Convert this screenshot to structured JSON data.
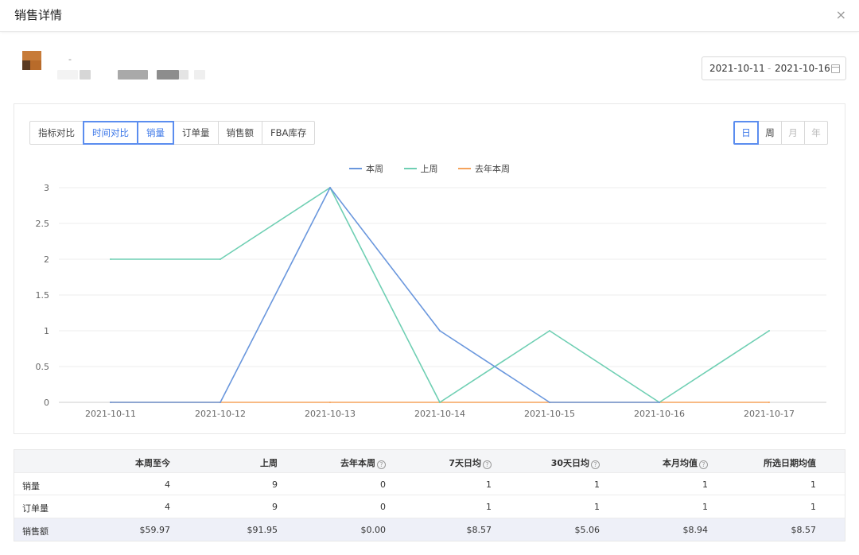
{
  "dialog": {
    "title": "销售详情",
    "close": "×"
  },
  "product": {
    "dash": "-"
  },
  "date_range": {
    "from": "2021-10-11",
    "sep": "-",
    "to": "2021-10-16"
  },
  "toolbar": {
    "compare_modes": [
      "指标对比",
      "时间对比"
    ],
    "compare_active": 1,
    "metrics": [
      "销量",
      "订单量",
      "销售额",
      "FBA库存"
    ],
    "metric_active": 0,
    "granularity": [
      "日",
      "周",
      "月",
      "年"
    ],
    "granularity_active": 0
  },
  "colors": {
    "this_week": "#6a97dd",
    "last_week": "#6fcfb3",
    "last_year": "#f5a35c",
    "accent": "#3a76e8"
  },
  "chart_data": {
    "type": "line",
    "categories": [
      "2021-10-11",
      "2021-10-12",
      "2021-10-13",
      "2021-10-14",
      "2021-10-15",
      "2021-10-16",
      "2021-10-17"
    ],
    "yticks": [
      "0",
      "0.5",
      "1",
      "1.5",
      "2",
      "2.5",
      "3"
    ],
    "ylim": [
      0,
      3
    ],
    "grid": true,
    "legend_position": "top-center",
    "series": [
      {
        "name": "本周",
        "color": "#6a97dd",
        "values": [
          0,
          0,
          3,
          1,
          0,
          0,
          null
        ]
      },
      {
        "name": "上周",
        "color": "#6fcfb3",
        "values": [
          2,
          2,
          3,
          0,
          1,
          0,
          1
        ]
      },
      {
        "name": "去年本周",
        "color": "#f5a35c",
        "values": [
          0,
          0,
          0,
          0,
          0,
          0,
          0
        ]
      }
    ]
  },
  "table": {
    "headers": [
      "",
      "本周至今",
      "上周",
      "去年本周",
      "7天日均",
      "30天日均",
      "本月均值",
      "所选日期均值"
    ],
    "help_columns": [
      3,
      4,
      5,
      6
    ],
    "rows": [
      {
        "label": "销量",
        "values": [
          "4",
          "9",
          "0",
          "1",
          "1",
          "1",
          "1"
        ]
      },
      {
        "label": "订单量",
        "values": [
          "4",
          "9",
          "0",
          "1",
          "1",
          "1",
          "1"
        ]
      },
      {
        "label": "销售额",
        "values": [
          "$59.97",
          "$91.95",
          "$0.00",
          "$8.57",
          "$5.06",
          "$8.94",
          "$8.57"
        ]
      }
    ]
  }
}
